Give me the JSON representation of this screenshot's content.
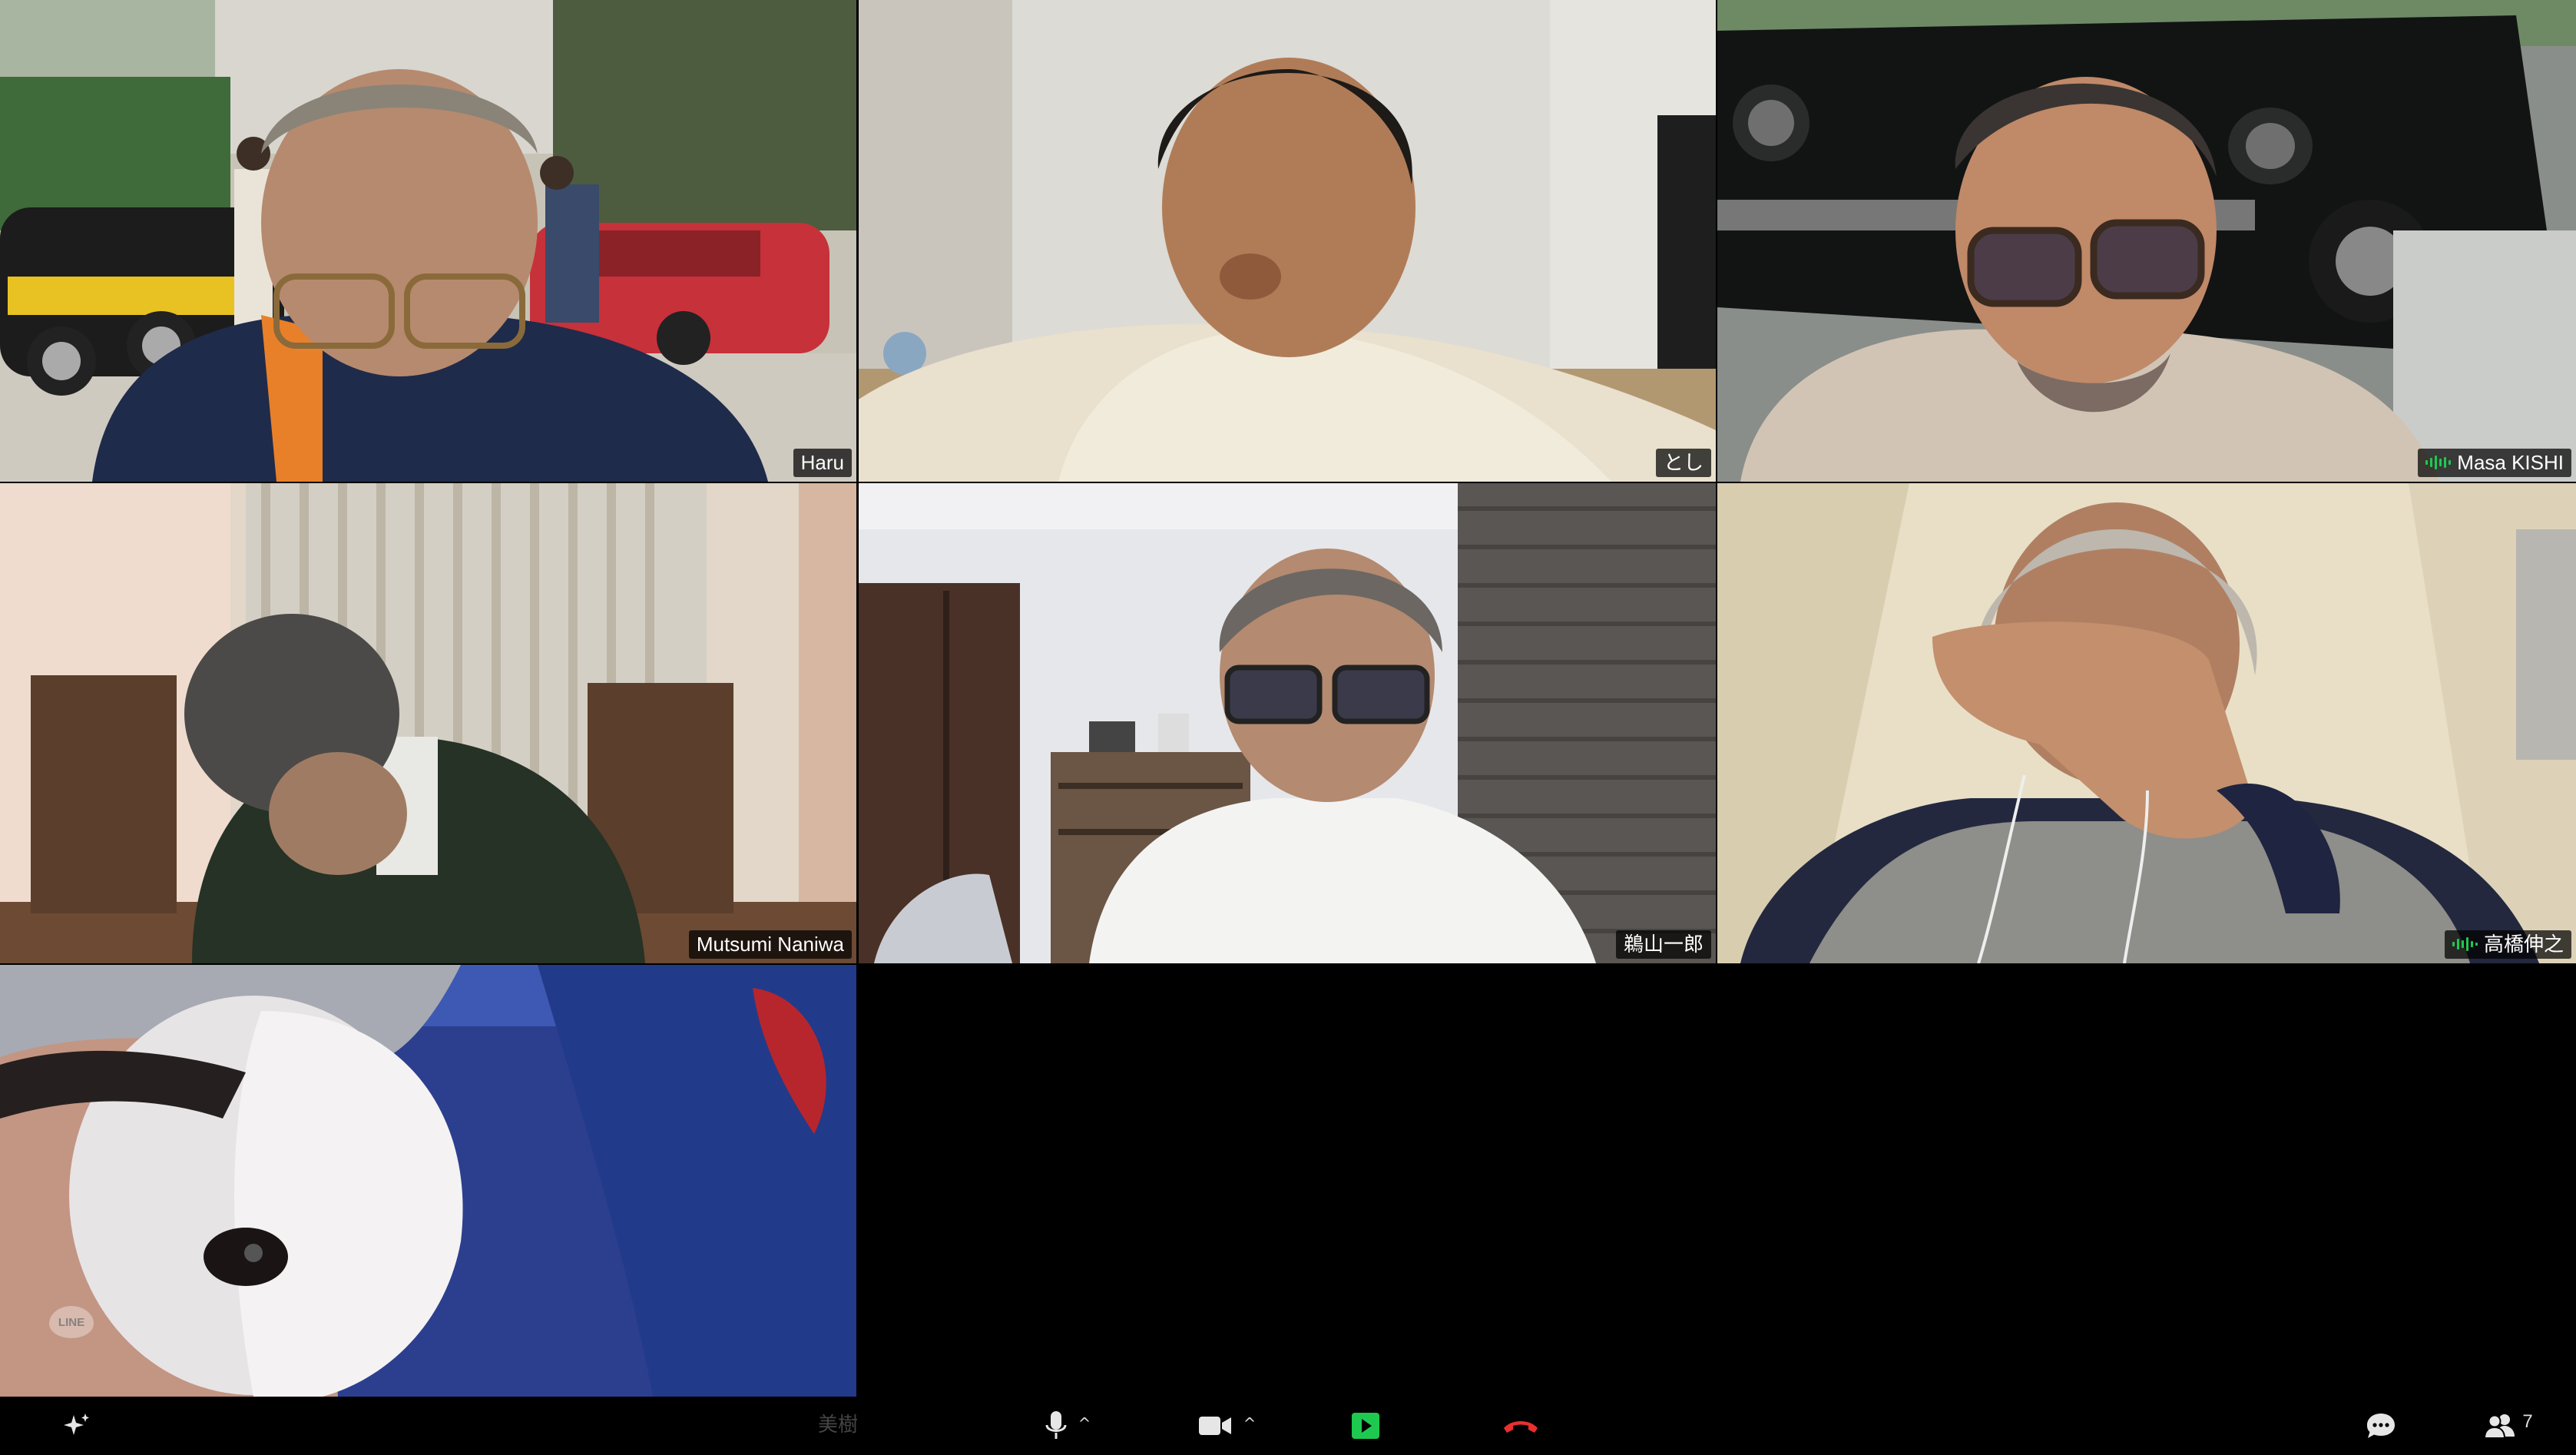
{
  "participants": [
    {
      "name": "Haru",
      "speaking": false
    },
    {
      "name": "とし",
      "speaking": false
    },
    {
      "name": "Masa KISHI",
      "speaking": true
    },
    {
      "name": "Mutsumi Naniwa",
      "speaking": false
    },
    {
      "name": "鵜山一郎",
      "speaking": false
    },
    {
      "name": "高橋伸之",
      "speaking": true
    },
    {
      "name": "美樹",
      "speaking": false
    }
  ],
  "watermark": "LINE",
  "toolbar": {
    "effects_icon": "sparkle-icon",
    "mic_icon": "microphone-icon",
    "video_icon": "camera-icon",
    "share_icon": "share-screen-icon",
    "end_icon": "end-call-icon",
    "chat_icon": "chat-icon",
    "participants_icon": "participants-icon",
    "participant_count": "7",
    "caret": "^"
  },
  "colors": {
    "speaking_border": "#1ec94f",
    "share_green": "#1ec94f",
    "end_red": "#e8302f",
    "background": "#000000"
  }
}
